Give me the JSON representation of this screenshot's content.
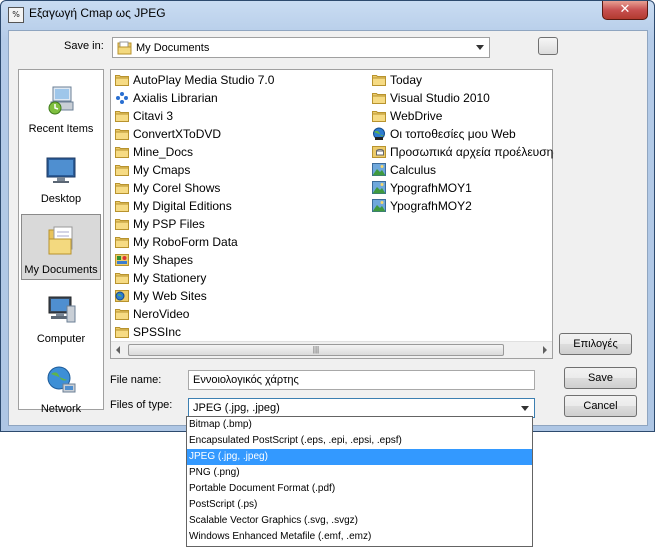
{
  "window": {
    "title": "Εξαγωγή Cmap ως JPEG",
    "app_icon_text": "%",
    "close_symbol": "✕"
  },
  "save_in": {
    "label": "Save in:",
    "value": "My Documents"
  },
  "places": [
    {
      "label": "Recent Items",
      "icon": "recent-items-icon",
      "selected": false
    },
    {
      "label": "Desktop",
      "icon": "desktop-icon",
      "selected": false
    },
    {
      "label": "My Documents",
      "icon": "my-documents-icon",
      "selected": true
    },
    {
      "label": "Computer",
      "icon": "computer-icon",
      "selected": false
    },
    {
      "label": "Network",
      "icon": "network-icon",
      "selected": false
    }
  ],
  "files_col1": [
    {
      "name": "AutoPlay Media Studio 7.0",
      "icon": "folder-icon"
    },
    {
      "name": "Axialis Librarian",
      "icon": "axialis-icon"
    },
    {
      "name": "Citavi 3",
      "icon": "folder-icon"
    },
    {
      "name": "ConvertXToDVD",
      "icon": "folder-icon"
    },
    {
      "name": "Mine_Docs",
      "icon": "folder-icon"
    },
    {
      "name": "My Cmaps",
      "icon": "folder-icon"
    },
    {
      "name": "My Corel Shows",
      "icon": "folder-icon"
    },
    {
      "name": "My Digital Editions",
      "icon": "folder-icon"
    },
    {
      "name": "My PSP Files",
      "icon": "folder-icon"
    },
    {
      "name": "My RoboForm Data",
      "icon": "folder-icon"
    },
    {
      "name": "My Shapes",
      "icon": "shapes-folder-icon"
    },
    {
      "name": "My Stationery",
      "icon": "folder-icon"
    },
    {
      "name": "My Web Sites",
      "icon": "web-sites-icon"
    },
    {
      "name": "NeroVideo",
      "icon": "folder-icon"
    },
    {
      "name": "SPSSInc",
      "icon": "folder-icon"
    }
  ],
  "files_col2": [
    {
      "name": "Today",
      "icon": "folder-icon"
    },
    {
      "name": "Visual Studio 2010",
      "icon": "folder-icon"
    },
    {
      "name": "WebDrive",
      "icon": "folder-icon"
    },
    {
      "name": "Οι τοποθεσίες μου Web",
      "icon": "web-places-icon"
    },
    {
      "name": "Προσωπικά αρχεία προέλευσης δεδομένων",
      "icon": "data-sources-icon"
    },
    {
      "name": "Calculus",
      "icon": "image-file-icon"
    },
    {
      "name": "YpografhMOY1",
      "icon": "image-file-icon"
    },
    {
      "name": "YpografhMOY2",
      "icon": "image-file-icon"
    }
  ],
  "file_name": {
    "label": "File name:",
    "value": "Εννοιολογικός χάρτης"
  },
  "file_type": {
    "label": "Files of type:",
    "value": "JPEG (.jpg, .jpeg)"
  },
  "buttons": {
    "options": "Επιλογές",
    "save": "Save",
    "cancel": "Cancel"
  },
  "type_options": [
    {
      "label": "Bitmap  (.bmp)",
      "selected": false
    },
    {
      "label": "Encapsulated PostScript (.eps, .epi, .epsi, .epsf)",
      "selected": false
    },
    {
      "label": "JPEG (.jpg, .jpeg)",
      "selected": true
    },
    {
      "label": "PNG (.png)",
      "selected": false
    },
    {
      "label": "Portable Document Format (.pdf)",
      "selected": false
    },
    {
      "label": "PostScript (.ps)",
      "selected": false
    },
    {
      "label": "Scalable Vector Graphics (.svg, .svgz)",
      "selected": false
    },
    {
      "label": "Windows Enhanced Metafile (.emf, .emz)",
      "selected": false
    }
  ],
  "scrollbar": {
    "thumb_grip": "|||"
  },
  "colors": {
    "selection": "#3399ff",
    "folder": "#e9c35a",
    "close": "#c75050"
  }
}
